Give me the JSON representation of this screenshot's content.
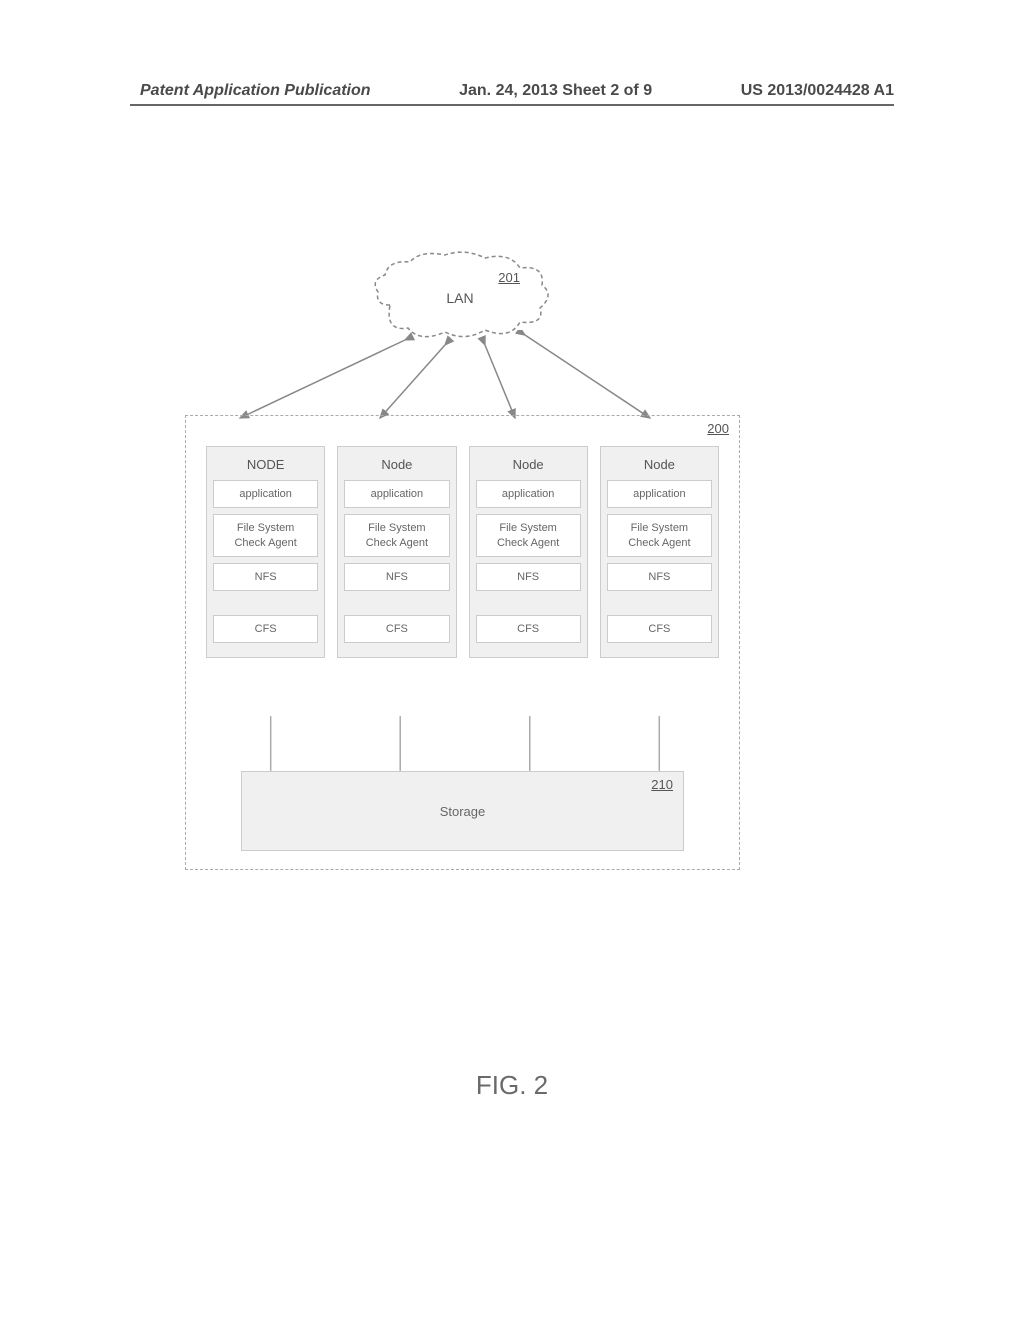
{
  "header": {
    "left": "Patent Application Publication",
    "mid": "Jan. 24, 2013  Sheet 2 of 9",
    "right": "US 2013/0024428 A1"
  },
  "cloud": {
    "label": "LAN",
    "ref": "201"
  },
  "cluster": {
    "ref": "200"
  },
  "node_labels": {
    "application": "application",
    "file_system_check_agent": "File System\nCheck Agent",
    "nfs": "NFS",
    "cfs": "CFS"
  },
  "nodes": [
    {
      "title": "NODE"
    },
    {
      "title": "Node"
    },
    {
      "title": "Node"
    },
    {
      "title": "Node"
    }
  ],
  "storage": {
    "label": "Storage",
    "ref": "210"
  },
  "figure": "FIG. 2"
}
